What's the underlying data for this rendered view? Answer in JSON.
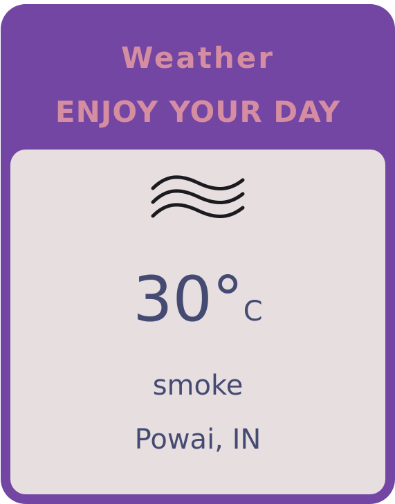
{
  "header": {
    "title": "Weather",
    "subtitle": "ENJOY YOUR DAY"
  },
  "weather": {
    "icon": "mist-wave-icon",
    "temperature": "30°",
    "unit": "C",
    "condition": "smoke",
    "location": "Powai, IN"
  },
  "colors": {
    "card_background": "#7446a3",
    "header_text": "#d58da2",
    "panel_background": "#e6dedf",
    "panel_text": "#454a73"
  }
}
